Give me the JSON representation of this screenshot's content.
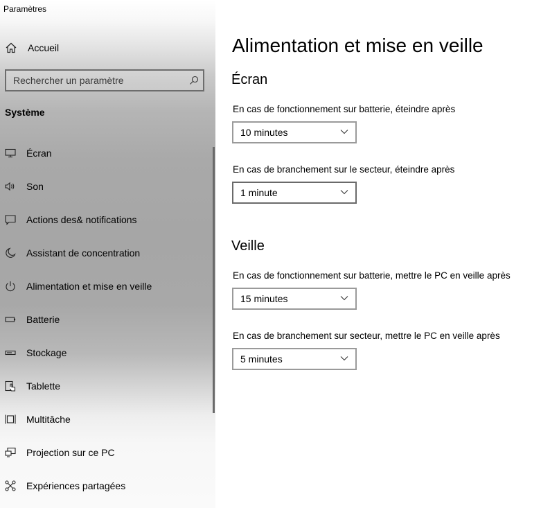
{
  "window": {
    "title": "Paramètres"
  },
  "sidebar": {
    "home": {
      "label": "Accueil",
      "icon": "home-icon"
    },
    "search": {
      "placeholder": "Rechercher un paramètre",
      "value": "",
      "icon": "search-icon"
    },
    "section_heading": "Système",
    "items": [
      {
        "label": "Écran",
        "icon": "monitor-icon"
      },
      {
        "label": "Son",
        "icon": "speaker-icon"
      },
      {
        "label": "Actions des& notifications",
        "icon": "notification-icon"
      },
      {
        "label": "Assistant de concentration",
        "icon": "moon-icon"
      },
      {
        "label": "Alimentation et mise en veille",
        "icon": "power-icon"
      },
      {
        "label": "Batterie",
        "icon": "battery-icon"
      },
      {
        "label": "Stockage",
        "icon": "storage-icon"
      },
      {
        "label": "Tablette",
        "icon": "tablet-icon"
      },
      {
        "label": "Multitâche",
        "icon": "multitask-icon"
      },
      {
        "label": "Projection sur ce PC",
        "icon": "projection-icon"
      },
      {
        "label": "Expériences partagées",
        "icon": "shared-experiences-icon"
      }
    ]
  },
  "main": {
    "title": "Alimentation et mise en veille",
    "screen": {
      "heading": "Écran",
      "battery_label": "En cas de fonctionnement sur batterie, éteindre après",
      "battery_value": "10 minutes",
      "plugged_label": "En cas de branchement sur le secteur, éteindre après",
      "plugged_value": "1 minute"
    },
    "sleep": {
      "heading": "Veille",
      "battery_label": "En cas de fonctionnement sur batterie, mettre le PC en veille après",
      "battery_value": "15 minutes",
      "plugged_label": "En cas de branchement sur secteur, mettre le PC en veille après",
      "plugged_value": "5 minutes"
    }
  }
}
